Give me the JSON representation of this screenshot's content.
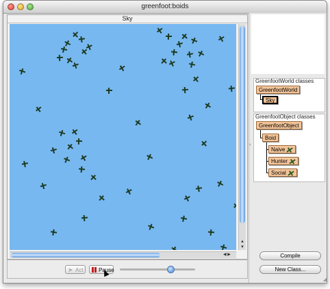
{
  "window": {
    "title": "greenfoot:boids"
  },
  "world": {
    "title": "Sky"
  },
  "boids_count": 58,
  "controls": {
    "act_label": "Act",
    "pause_label": "Pause"
  },
  "classes": {
    "world_group_label": "GreenfootWorld classes",
    "world_root": "GreenfootWorld",
    "world_sub": "Sky",
    "object_group_label": "GreenfootObject classes",
    "object_root": "GreenfootObject",
    "boid": "Boid",
    "naive": "Naive",
    "hunter": "Hunter",
    "social": "Social"
  },
  "buttons": {
    "compile": "Compile",
    "new_class": "New Class..."
  },
  "icons": [
    "close-light",
    "minimize-light",
    "zoom-light",
    "act-arrow-icon",
    "pause-icon",
    "boid-icon"
  ],
  "colors": {
    "sky": "#78b8f0",
    "class_box": "#f3c59a",
    "boid": "#1c3a20"
  }
}
